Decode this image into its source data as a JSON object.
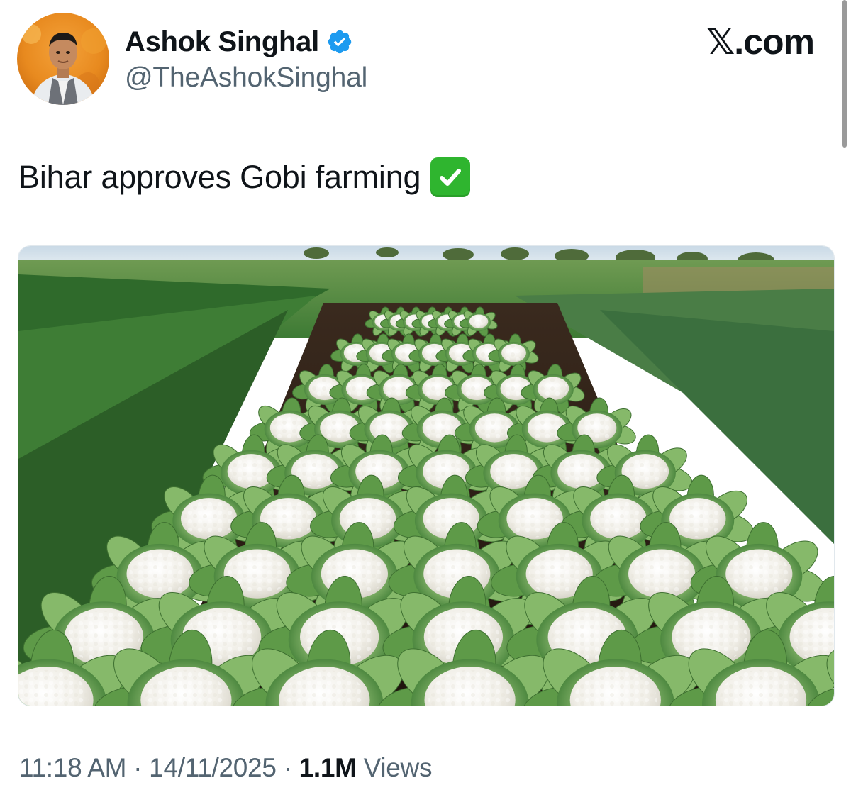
{
  "author": {
    "display_name": "Ashok Singhal",
    "handle": "@TheAshokSinghal",
    "verified": true
  },
  "brand": "𝕏.com",
  "tweet": {
    "text": "Bihar approves Gobi farming",
    "emoji": "check-mark-button"
  },
  "meta": {
    "time": "11:18 AM",
    "separator": " · ",
    "date": "14/11/2025",
    "views_count": "1.1M",
    "views_label": " Views"
  },
  "colors": {
    "verified_blue": "#1d9bf0",
    "emoji_green": "#2fb52f",
    "secondary_text": "#536471"
  }
}
